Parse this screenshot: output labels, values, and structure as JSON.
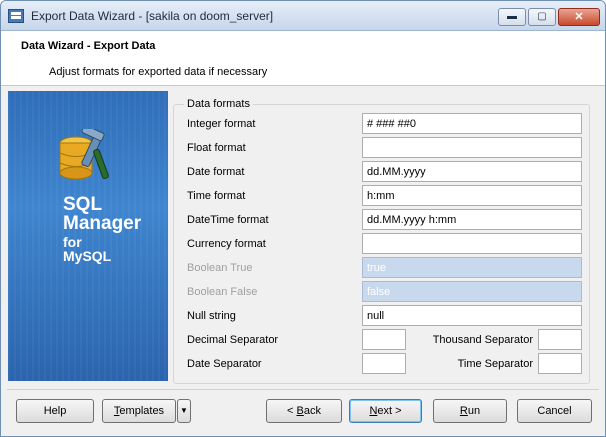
{
  "window": {
    "title": "Export Data Wizard - [sakila on doom_server]",
    "minimize_glyph": "▬",
    "maximize_glyph": "▢",
    "close_glyph": "✕"
  },
  "header": {
    "title": "Data Wizard - Export Data",
    "subtitle": "Adjust formats for exported data if necessary"
  },
  "banner": {
    "line1": "SQL",
    "line2": "Manager",
    "line3": "for",
    "line4": "MySQL"
  },
  "group": {
    "legend": "Data formats"
  },
  "formats": {
    "integer": {
      "label": "Integer format",
      "value": "# ### ##0"
    },
    "float": {
      "label": "Float format",
      "value": ""
    },
    "date": {
      "label": "Date format",
      "value": "dd.MM.yyyy"
    },
    "time": {
      "label": "Time format",
      "value": "h:mm"
    },
    "datetime": {
      "label": "DateTime format",
      "value": "dd.MM.yyyy h:mm"
    },
    "currency": {
      "label": "Currency format",
      "value": ""
    },
    "boolean_true": {
      "label": "Boolean True",
      "value": "true"
    },
    "boolean_false": {
      "label": "Boolean False",
      "value": "false"
    },
    "null_string": {
      "label": "Null string",
      "value": "null"
    }
  },
  "separators": {
    "decimal": {
      "label": "Decimal Separator",
      "value": ""
    },
    "thousand": {
      "label": "Thousand Separator",
      "value": ""
    },
    "date": {
      "label": "Date Separator",
      "value": ""
    },
    "time": {
      "label": "Time Separator",
      "value": ""
    }
  },
  "buttons": {
    "help": "Help",
    "templates_prefix": "T",
    "templates_rest": "emplates",
    "templates_dropdown": "▼",
    "back_prefix": "< ",
    "back_u": "B",
    "back_rest": "ack",
    "next_u": "N",
    "next_rest": "ext >",
    "run_u": "R",
    "run_rest": "un",
    "cancel": "Cancel"
  },
  "colors": {
    "banner_blue": "#3f85cf",
    "disabled_field": "#c8d9ee",
    "window_border": "#6f8fb3"
  }
}
